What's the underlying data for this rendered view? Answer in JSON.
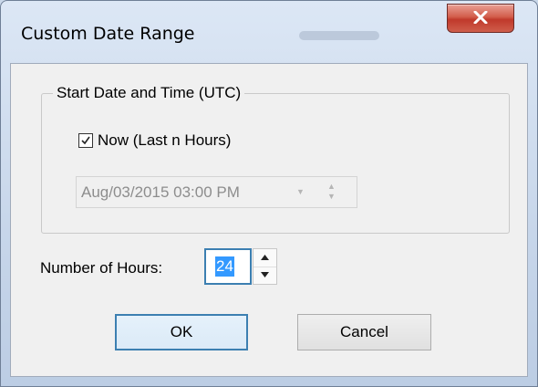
{
  "window": {
    "title": "Custom Date Range",
    "close_icon": "close-x-icon",
    "accent_color": "#c0392b"
  },
  "start_group": {
    "legend": "Start Date and Time (UTC)",
    "now_checkbox": {
      "label": "Now (Last n Hours)",
      "checked": true
    },
    "datetime_value": "Aug/03/2015 03:00 PM",
    "datetime_enabled": false
  },
  "hours": {
    "label": "Number of Hours:",
    "value": "24"
  },
  "buttons": {
    "ok_label": "OK",
    "cancel_label": "Cancel"
  }
}
